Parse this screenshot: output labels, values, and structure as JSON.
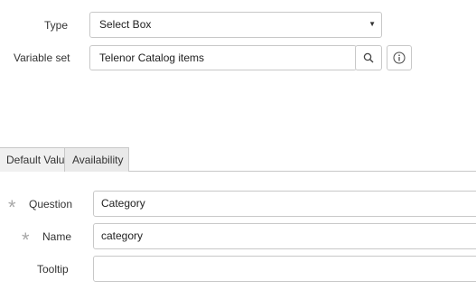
{
  "type_field": {
    "label": "Type",
    "value": "Select Box"
  },
  "variable_set_field": {
    "label": "Variable set",
    "value": "Telenor Catalog items"
  },
  "tabs": [
    {
      "label": "Default Value"
    },
    {
      "label": "Availability"
    }
  ],
  "question_field": {
    "label": "Question",
    "value": "Category",
    "required_mark": "*"
  },
  "name_field": {
    "label": "Name",
    "value": "category",
    "required_mark": "*"
  },
  "tooltip_field": {
    "label": "Tooltip",
    "value": ""
  },
  "icons": {
    "type_dropdown": "caret-down-icon",
    "lookup": "search-icon",
    "info": "info-icon",
    "required": "asterisk-icon"
  }
}
